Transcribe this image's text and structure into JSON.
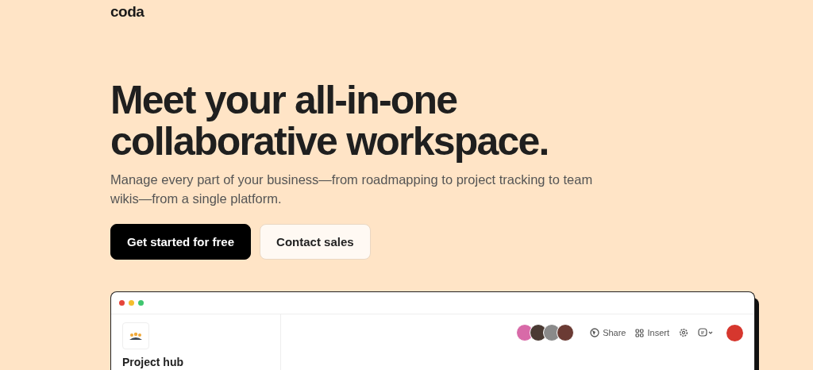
{
  "logo": "coda",
  "heading": "Meet your all-in-one collaborative workspace.",
  "subtitle": "Manage every part of your business—from roadmapping to project tracking to team wikis—from a single platform.",
  "buttons": [
    {
      "label": "Get started for free",
      "kind": "primary"
    },
    {
      "label": "Contact sales",
      "kind": "secondary"
    }
  ],
  "app_window": {
    "sidebar": {
      "title": "Project hub"
    },
    "toolbar": {
      "collaborators": [
        {
          "color": "#d86aa8"
        },
        {
          "color": "#4a3a33"
        },
        {
          "color": "#8a8a8a"
        },
        {
          "color": "#6b3b34"
        }
      ],
      "actions": [
        "Share",
        "Insert"
      ]
    }
  }
}
